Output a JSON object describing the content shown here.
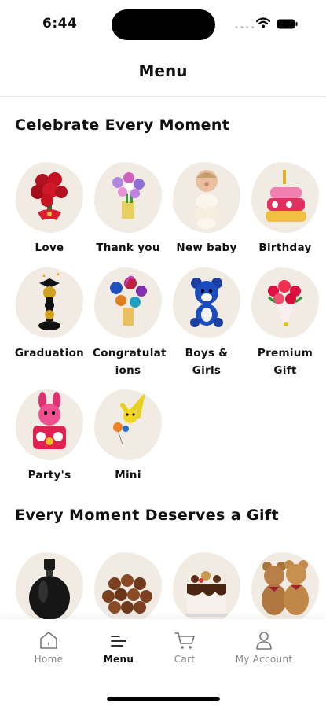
{
  "status": {
    "time": "6:44"
  },
  "header": {
    "title": "Menu"
  },
  "sections": [
    {
      "title": "Celebrate Every Moment",
      "categories": [
        {
          "label": "Love",
          "icon": "heart-bouquet-icon"
        },
        {
          "label": "Thank you",
          "icon": "flower-balloon-icon"
        },
        {
          "label": "New baby",
          "icon": "baby-balloon-icon"
        },
        {
          "label": "Birthday",
          "icon": "cake-balloon-icon"
        },
        {
          "label": "Graduation",
          "icon": "graduation-tower-icon"
        },
        {
          "label": "Congratulat\nions",
          "icon": "congrats-bouquet-icon"
        },
        {
          "label": "Boys &\nGirls",
          "icon": "bear-balloon-icon"
        },
        {
          "label": "Premium\nGift",
          "icon": "rose-bouquet-icon"
        },
        {
          "label": "Party's",
          "icon": "bunny-balloon-icon"
        },
        {
          "label": "Mini",
          "icon": "mini-balloon-icon"
        }
      ]
    },
    {
      "title": "Every Moment Deserves a Gift",
      "products": [
        {
          "icon": "perfume-bottle-image"
        },
        {
          "icon": "chocolate-balls-image"
        },
        {
          "icon": "chocolate-cake-image"
        },
        {
          "icon": "teddy-bears-image"
        }
      ]
    }
  ],
  "tabs": [
    {
      "label": "Home",
      "icon": "home-icon",
      "active": false
    },
    {
      "label": "Menu",
      "icon": "menu-icon",
      "active": true
    },
    {
      "label": "Cart",
      "icon": "cart-icon",
      "active": false
    },
    {
      "label": "My Account",
      "icon": "account-icon",
      "active": false
    }
  ],
  "colors": {
    "tile_bg": "#f1ebe4",
    "active_tab": "#111111",
    "inactive_tab": "#888888"
  }
}
